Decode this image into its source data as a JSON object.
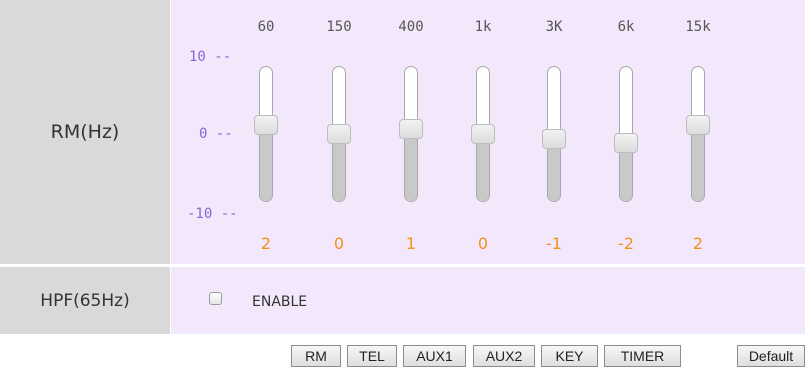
{
  "rm_section": {
    "label": "RM(Hz)",
    "scale": {
      "max_label": "10 --",
      "mid_label": "0 --",
      "min_label": "-10 --",
      "min": -10,
      "max": 10
    },
    "bands": [
      {
        "freq": "60",
        "value": 2
      },
      {
        "freq": "150",
        "value": 0
      },
      {
        "freq": "400",
        "value": 1
      },
      {
        "freq": "1k",
        "value": 0
      },
      {
        "freq": "3K",
        "value": -1
      },
      {
        "freq": "6k",
        "value": -2
      },
      {
        "freq": "15k",
        "value": 2
      }
    ]
  },
  "hpf_section": {
    "label": "HPF(65Hz)",
    "enable_label": "ENABLE",
    "enabled": false
  },
  "buttons": [
    "RM",
    "TEL",
    "AUX1",
    "AUX2",
    "KEY",
    "TIMER"
  ],
  "default_button": "Default",
  "colors": {
    "value": "#f0931a",
    "scale": "#8b63d9",
    "panel": "#f3e8fb",
    "label_bg": "#d9d9d9"
  }
}
